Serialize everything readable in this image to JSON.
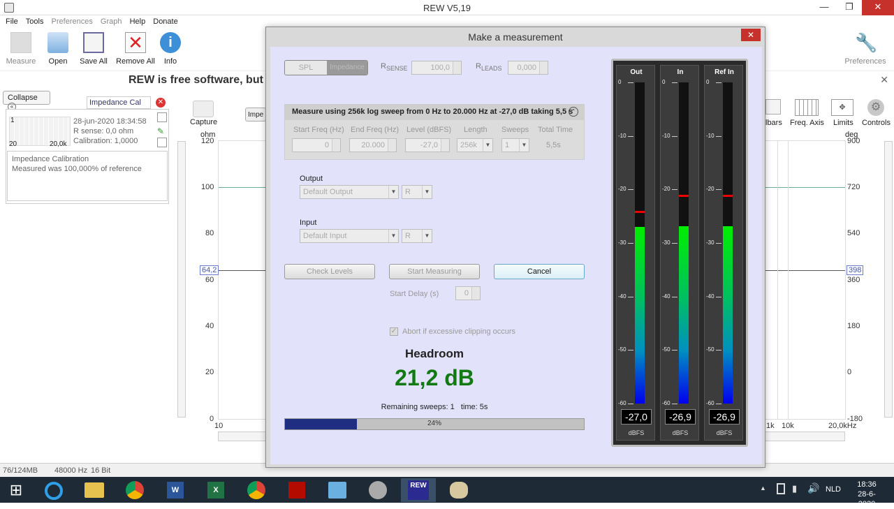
{
  "window": {
    "title": "REW V5,19",
    "minimize": "—",
    "maximize": "❐",
    "close": "✕"
  },
  "menu": [
    "File",
    "Tools",
    "Preferences",
    "Graph",
    "Help",
    "Donate"
  ],
  "toolbar": [
    {
      "label": "Measure",
      "icon": "measure-icon"
    },
    {
      "label": "Open",
      "icon": "folder-icon"
    },
    {
      "label": "Save All",
      "icon": "save-icon"
    },
    {
      "label": "Remove All",
      "icon": "remove-icon"
    },
    {
      "label": "Info",
      "icon": "info-icon"
    }
  ],
  "toolbar_right": {
    "label": "Preferences",
    "icon": "wrench-icon"
  },
  "banner": "REW is free software, but if",
  "left_panel": {
    "collapse_label": "Collapse",
    "measurement_name": "Impedance Cal",
    "date": "28-jun-2020 18:34:58",
    "rsense": "R sense: 0,0 ohm",
    "calibration": "Calibration: 1,0000",
    "thumb_x_min": "20",
    "thumb_x_max": "20,0k",
    "thumb_label": "1",
    "notes_title": "Impedance Calibration",
    "notes_text": "Measured was 100,000% of reference"
  },
  "graph_toolbar": {
    "capture": "Capture",
    "left_tab": "Impe",
    "right": [
      "lbars",
      "Freq. Axis",
      "Limits",
      "Controls"
    ]
  },
  "graph": {
    "left_unit": "ohm",
    "right_unit": "deg",
    "left_ticks": [
      "120",
      "100",
      "80",
      "60",
      "40",
      "20",
      "0"
    ],
    "right_ticks": [
      "900",
      "720",
      "540",
      "360",
      "180",
      "0",
      "-180"
    ],
    "x_ticks": [
      "10",
      "1k",
      "10k",
      "20,0kHz"
    ],
    "cursor_left": "64,2",
    "cursor_right": "398"
  },
  "statusbar": {
    "memory": "76/124MB",
    "samplerate": "48000 Hz",
    "bits": "16 Bit"
  },
  "taskbar": {
    "lang": "NLD",
    "time": "18:36",
    "date": "28-6-2020",
    "chevron": "▲"
  },
  "dialog": {
    "title": "Make a measurement",
    "close": "✕",
    "toggle": {
      "spl": "SPL",
      "impedance": "Impedance"
    },
    "rsense_label": "R",
    "rsense_sub": "SENSE",
    "rsense_value": "100,0",
    "rleads_label": "R",
    "rleads_sub": "LEADS",
    "rleads_value": "0,000",
    "sweep_header": "Measure using 256k log sweep from 0 Hz to 20.000 Hz at -27,0 dB taking 5,5 s",
    "sweep_cols": [
      "Start Freq (Hz)",
      "End Freq (Hz)",
      "Level (dBFS)",
      "Length",
      "Sweeps",
      "Total Time"
    ],
    "sweep_vals": {
      "start": "0",
      "end": "20.000",
      "level": "-27,0",
      "length": "256k",
      "sweeps": "1",
      "total": "5,5s"
    },
    "output_label": "Output",
    "output_device": "Default Output",
    "output_channel": "R",
    "input_label": "Input",
    "input_device": "Default Input",
    "input_channel": "R",
    "check_levels": "Check Levels",
    "start_measuring": "Start Measuring",
    "cancel": "Cancel",
    "start_delay_label": "Start Delay (s)",
    "start_delay_value": "0",
    "abort_clipping": "Abort if excessive clipping occurs",
    "headroom_title": "Headroom",
    "headroom_value": "21,2 dB",
    "remaining": "Remaining sweeps: 1   time: 5s",
    "progress": 0.24,
    "progress_text": "24%"
  },
  "meters": [
    {
      "title": "Out",
      "value": "-27,0",
      "level_db": -27.0,
      "peak_db": -24.0
    },
    {
      "title": "In",
      "value": "-26,9",
      "level_db": -26.9,
      "peak_db": -21.0
    },
    {
      "title": "Ref In",
      "value": "-26,9",
      "level_db": -26.9,
      "peak_db": -21.0
    }
  ],
  "meter_ticks": [
    "0",
    "-10",
    "-20",
    "-30",
    "-40",
    "-50",
    "-60"
  ],
  "meter_unit": "dBFS",
  "colors": {
    "dialog_bg": "#e2e2fa",
    "headroom": "#137a13",
    "progress": "#1f2e80",
    "close": "#c7312b"
  }
}
